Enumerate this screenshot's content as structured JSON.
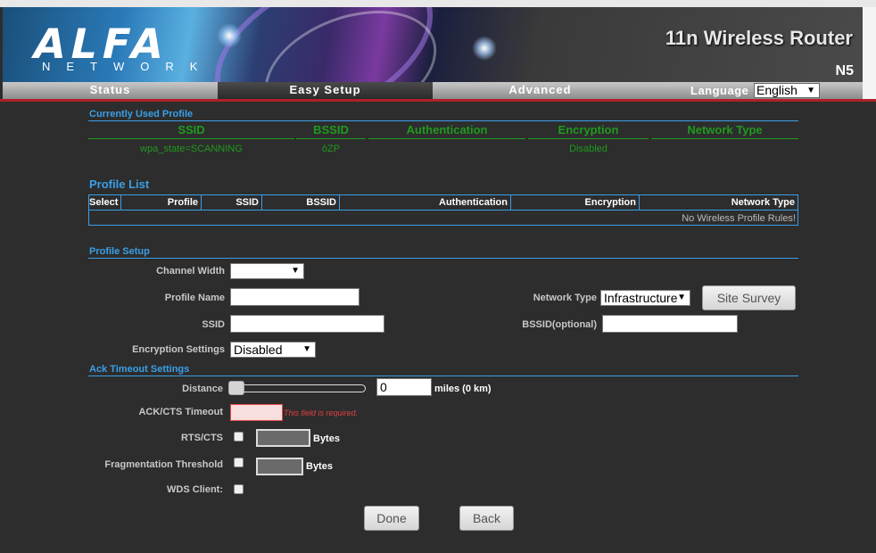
{
  "header": {
    "logo_text": "ALFA",
    "logo_sub": "NETWORK",
    "title": "11n Wireless Router",
    "model": "N5"
  },
  "nav": {
    "tabs": [
      {
        "label": "Status"
      },
      {
        "label": "Easy Setup",
        "active": true
      },
      {
        "label": "Advanced"
      }
    ],
    "language_label": "Language",
    "language_value": "English"
  },
  "current_profile": {
    "title": "Currently Used Profile",
    "headers": [
      "SSID",
      "BSSID",
      "Authentication",
      "Encryption",
      "Network Type"
    ],
    "values": [
      "wpa_state=SCANNING",
      "òZP",
      "",
      "Disabled",
      ""
    ]
  },
  "profile_list": {
    "title": "Profile List",
    "headers": [
      "Select",
      "Profile",
      "SSID",
      "BSSID",
      "Authentication",
      "Encryption",
      "Network Type"
    ],
    "empty_text": "No Wireless Profile Rules!"
  },
  "profile_setup": {
    "title": "Profile Setup",
    "channel_width_label": "Channel Width",
    "channel_width_value": "",
    "profile_name_label": "Profile Name",
    "profile_name_value": "",
    "ssid_label": "SSID",
    "ssid_value": "",
    "encryption_label": "Encryption Settings",
    "encryption_value": "Disabled",
    "network_type_label": "Network Type",
    "network_type_value": "Infrastructure",
    "site_survey_label": "Site Survey",
    "bssid_label": "BSSID(optional)",
    "bssid_value": ""
  },
  "ack": {
    "title": "Ack Timeout Settings",
    "distance_label": "Distance",
    "distance_value": "0",
    "distance_unit": "miles (0 km)",
    "distance_slider_level": 0,
    "ack_cts_label": "ACK/CTS Timeout",
    "ack_cts_error": "This field is required.",
    "rts_label": "RTS/CTS",
    "frag_label": "Fragmentation Threshold",
    "wds_label": "WDS Client:",
    "bytes": "Bytes"
  },
  "actions": {
    "done": "Done",
    "back": "Back"
  },
  "colors": {
    "accent_blue": "#3a9fe8",
    "profile_green": "#1f9a1f",
    "error_red": "#e04040",
    "nav_redline": "#b0202a"
  }
}
